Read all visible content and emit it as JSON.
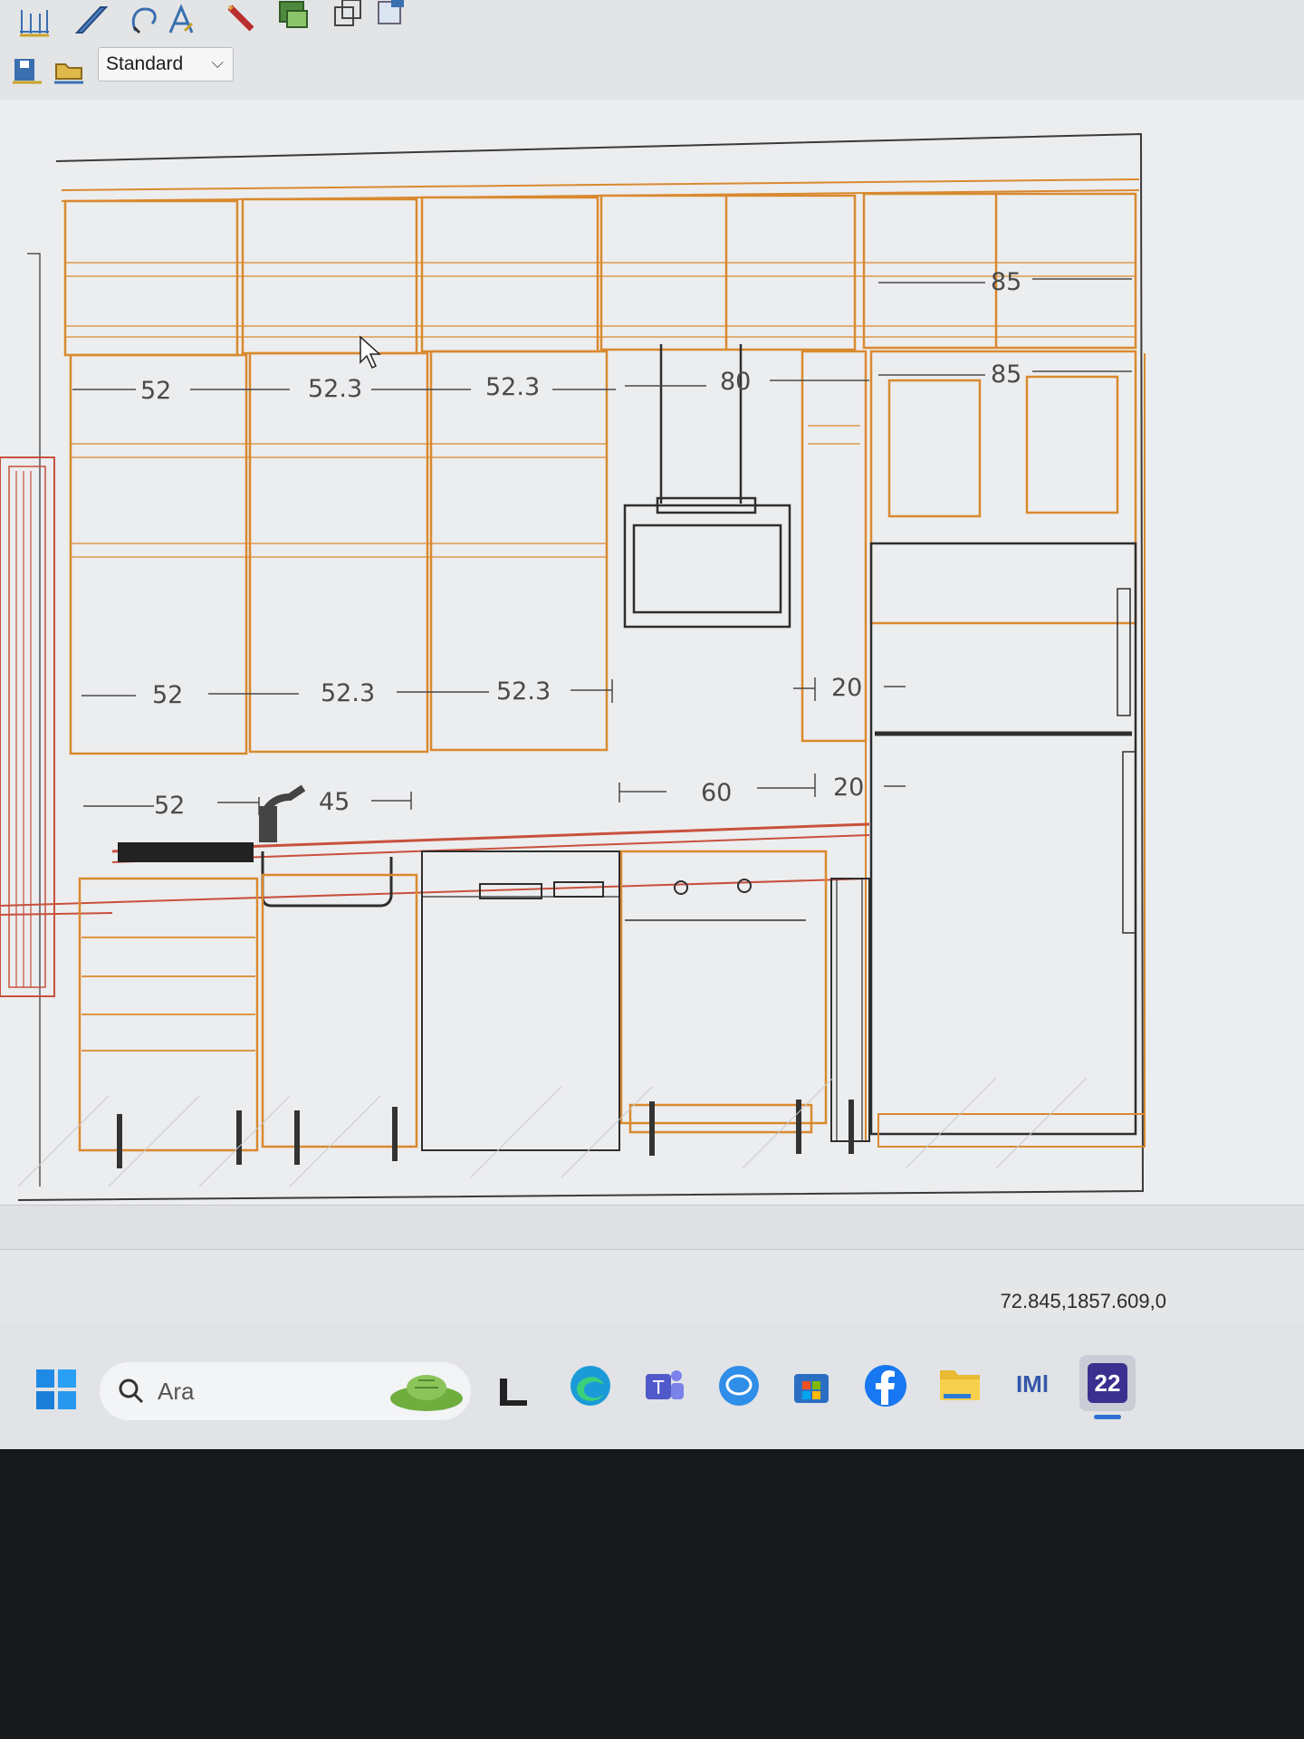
{
  "toolbar": {
    "icons": [
      "grid-dimension-icon",
      "shape-draw-icon",
      "lasso-select-icon",
      "text-style-icon",
      "pencil-icon",
      "layer-icon",
      "copy-icon",
      "properties-icon",
      "save-layout-icon",
      "load-layout-icon"
    ],
    "style_select": {
      "value": "Standard"
    }
  },
  "drawing": {
    "upper_dims": [
      "52",
      "52.3",
      "52.3",
      "80",
      "85",
      "85"
    ],
    "middle_dims": [
      "52",
      "52.3",
      "52.3",
      "20"
    ],
    "lower_dims": [
      "52",
      "45",
      "60",
      "20"
    ]
  },
  "status": {
    "coordinates": "72.845,1857.609,0"
  },
  "taskbar": {
    "search_placeholder": "Ara",
    "apps": [
      "start-icon",
      "widgets-icon",
      "terminal-icon",
      "edge-icon",
      "teams-icon",
      "chat-icon",
      "store-icon",
      "facebook-icon",
      "file-explorer-icon",
      "iml-icon",
      "app-22-icon"
    ],
    "app_22_label": "22",
    "iml_label": "IMl"
  },
  "colors": {
    "cabinet": "#d9892f",
    "cabinet_red": "#c8513c",
    "line": "#2e2e2e",
    "taskbar_bg": "#e1e3e6"
  }
}
